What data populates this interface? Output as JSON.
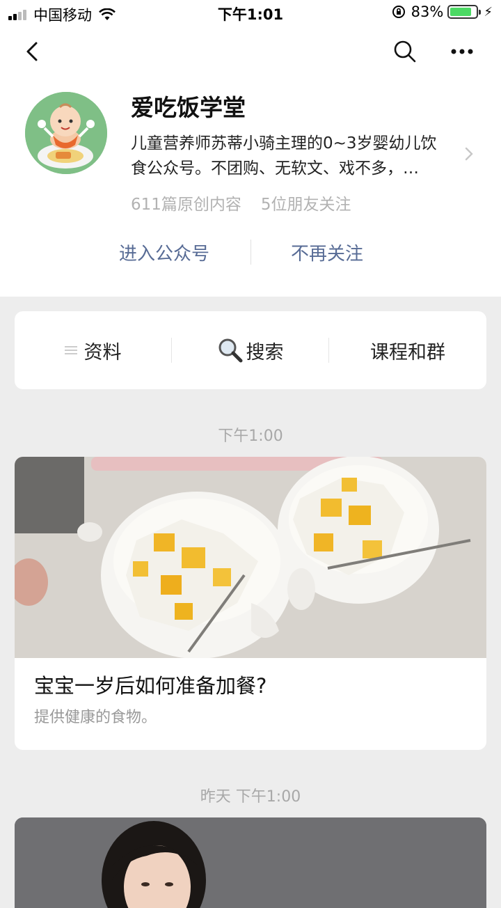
{
  "status_bar": {
    "carrier": "中国移动",
    "time": "下午1:01",
    "battery_percent": "83%",
    "battery_level": 0.83
  },
  "account": {
    "name": "爱吃饭学堂",
    "description": "儿童营养师苏蒂小骑主理的0~3岁婴幼儿饮食公众号。不团购、无软文、戏不多，…",
    "original_count": "611篇原创内容",
    "friends_following": "5位朋友关注",
    "enter_label": "进入公众号",
    "unfollow_label": "不再关注"
  },
  "menu": {
    "items": [
      {
        "label": "资料",
        "icon": "list-icon"
      },
      {
        "label": "搜索",
        "icon": "magnifier-icon"
      },
      {
        "label": "课程和群"
      }
    ]
  },
  "feed": {
    "items": [
      {
        "time": "下午1:00",
        "title": "宝宝一岁后如何准备加餐?",
        "digest": "提供健康的食物。"
      },
      {
        "time": "昨天 下午1:00"
      }
    ]
  },
  "colors": {
    "link": "#576b95",
    "background": "#ededed",
    "battery": "#4cd964",
    "avatar_bg": "#7fbf86"
  }
}
